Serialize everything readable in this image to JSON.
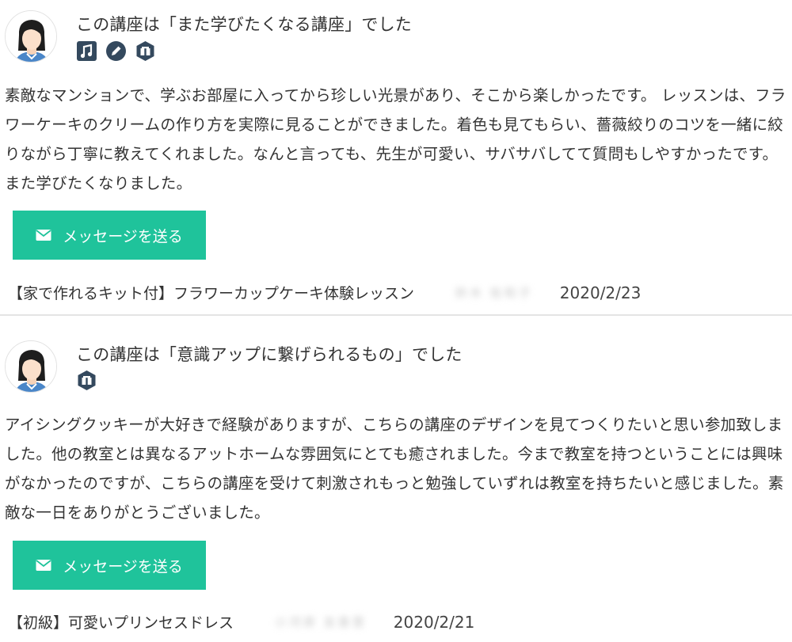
{
  "colors": {
    "accent_button": "#1fc39b",
    "badge": "#34495e",
    "text": "#333333",
    "divider": "#e4e4e4"
  },
  "reviews": [
    {
      "avatar_icon": "avatar-woman-icon",
      "headline": "この講座は「また学びたくなる講座」でした",
      "badges": [
        "music-note-icon",
        "pencil-icon",
        "gift-box-icon"
      ],
      "body": "素敵なマンションで、学ぶお部屋に入ってから珍しい光景があり、そこから楽しかったです。 レッスンは、フラワーケーキのクリームの作り方を実際に見ることができました。着色も見てもらい、薔薇絞りのコツを一緒に絞りながら丁寧に教えてくれました。なんと言っても、先生が可愛い、サバサバしてて質問もしやすかったです。また学びたくなりました。",
      "message_button": "メッセージを送る",
      "course_title": "【家で作れるキット付】フラワーカップケーキ体験レッスン",
      "reviewer_name": "鈴木 佐和子",
      "date": "2020/2/23"
    },
    {
      "avatar_icon": "avatar-woman-icon",
      "headline": "この講座は「意識アップに繋げられるもの」でした",
      "badges": [
        "gift-box-icon"
      ],
      "body": "アイシングクッキーが大好きで経験がありますが、こちらの講座のデザインを見てつくりたいと思い参加致しました。他の教室とは異なるアットホームな雰囲気にとても癒されました。今まで教室を持つということには興味がなかったのですが、こちらの講座を受けて刺激されもっと勉強していずれは教室を持ちたいと感じました。素敵な一日をありがとうございました。",
      "message_button": "メッセージを送る",
      "course_title": "【初級】可愛いプリンセスドレス",
      "reviewer_name": "小河原 友香里",
      "date": "2020/2/21"
    }
  ]
}
